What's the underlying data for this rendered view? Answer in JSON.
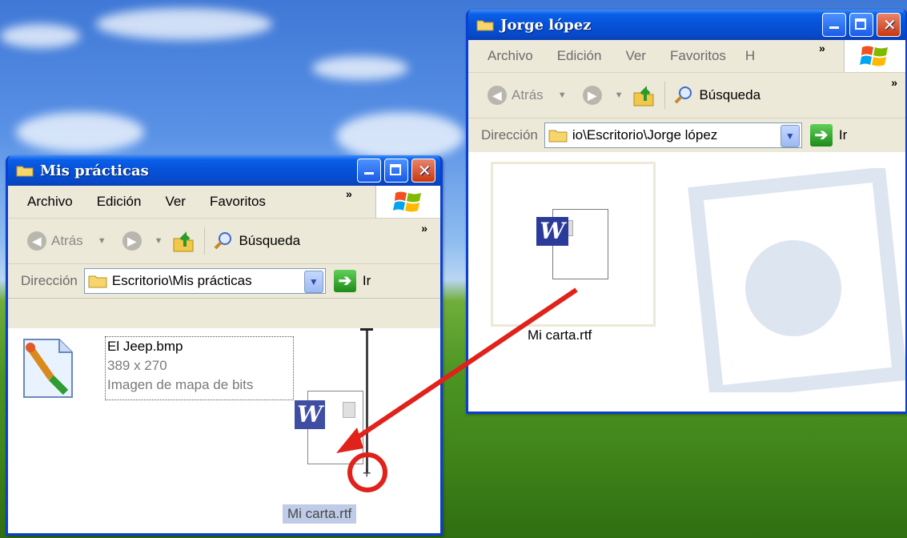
{
  "left_window": {
    "title": "Mis prácticas",
    "menu": [
      "Archivo",
      "Edición",
      "Ver",
      "Favoritos"
    ],
    "menu_more": "»",
    "toolbar": {
      "back": "Atrás",
      "search": "Búsqueda",
      "more": "»"
    },
    "address": {
      "label": "Dirección",
      "value": "Escritorio\\Mis prácticas",
      "go": "Ir"
    },
    "file": {
      "name": "El Jeep.bmp",
      "dims": "389 x 270",
      "type": "Imagen de mapa de bits",
      "icon": "paint-bitmap-icon"
    },
    "drag_label": "Mi carta.rtf"
  },
  "right_window": {
    "title": "Jorge lópez",
    "menu": [
      "Archivo",
      "Edición",
      "Ver",
      "Favoritos",
      "H"
    ],
    "menu_more": "»",
    "toolbar": {
      "back": "Atrás",
      "search": "Búsqueda",
      "more": "»"
    },
    "address": {
      "label": "Dirección",
      "value": "io\\Escritorio\\Jorge lópez",
      "go": "Ir"
    },
    "file": {
      "name": "Mi carta.rtf",
      "icon": "word-document-icon"
    }
  },
  "annotation": {
    "arrow_color": "#e0221b",
    "circle_color": "#e0221b"
  }
}
